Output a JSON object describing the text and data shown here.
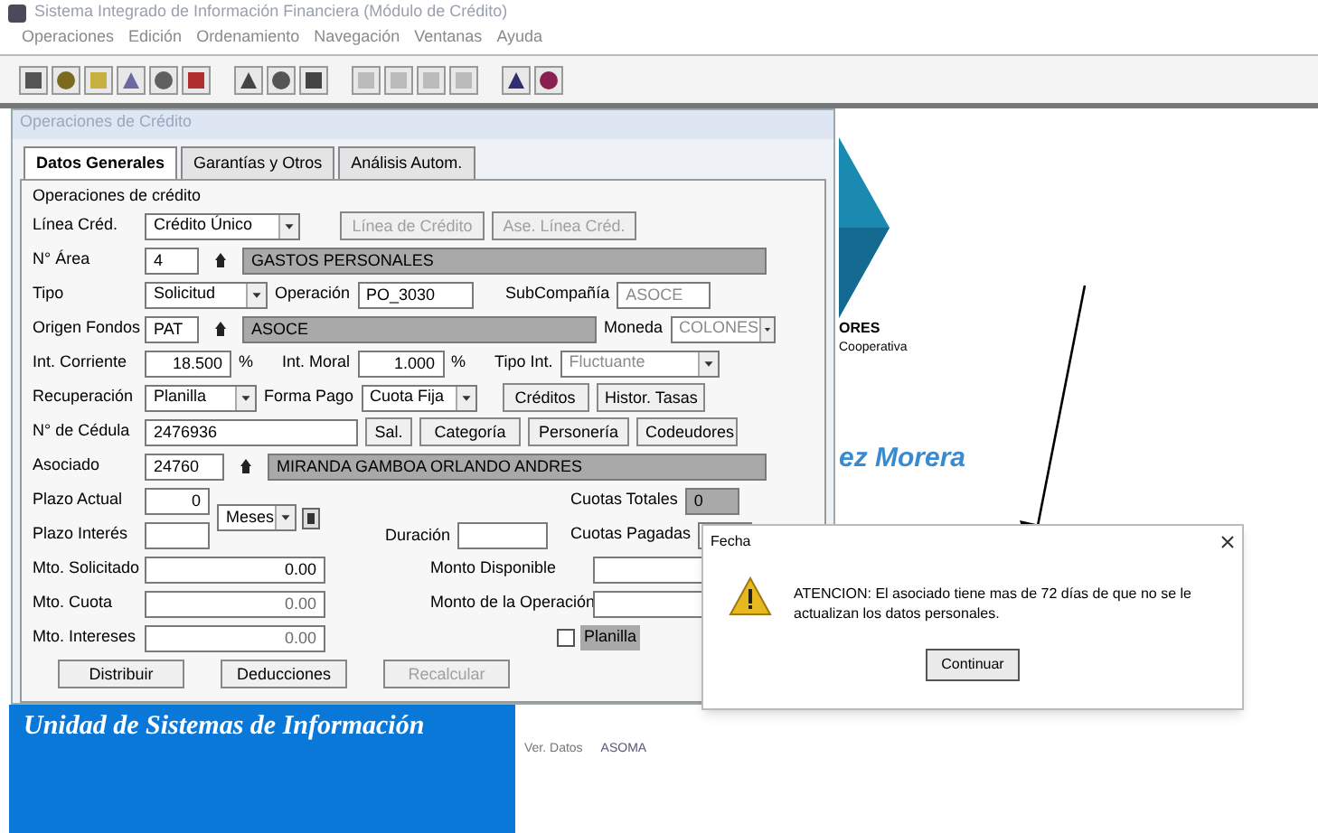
{
  "window": {
    "title": "Sistema Integrado de Información Financiera (Módulo de Crédito)"
  },
  "menu": [
    "Operaciones",
    "Edición",
    "Ordenamiento",
    "Navegación",
    "Ventanas",
    "Ayuda"
  ],
  "form_window": {
    "title": "Operaciones de Crédito",
    "tabs": [
      {
        "label": "Datos Generales",
        "selected": true
      },
      {
        "label": "Garantías y Otros",
        "selected": false
      },
      {
        "label": "Análisis Autom.",
        "selected": false
      }
    ],
    "group_label": "Operaciones de crédito",
    "linea": {
      "label": "Línea Créd.",
      "value": "Crédito Único",
      "buttons": [
        {
          "label": "Línea de Crédito",
          "disabled": true
        },
        {
          "label": "Ase. Línea Créd.",
          "disabled": true
        }
      ]
    },
    "area": {
      "label": "N° Área",
      "code": "4",
      "name": "GASTOS PERSONALES"
    },
    "tipo": {
      "label": "Tipo",
      "value": "Solicitud",
      "operacion_label": "Operación",
      "operacion": "PO_3030",
      "subcompania_label": "SubCompañía",
      "subcompania": "ASOCE"
    },
    "origen": {
      "label": "Origen Fondos",
      "code": "PAT",
      "name": "ASOCE",
      "moneda_label": "Moneda",
      "moneda": "COLONES"
    },
    "interes": {
      "label": "Int. Corriente",
      "value": "18.500",
      "unit": "%",
      "moral_label": "Int. Moral",
      "moral": "1.000",
      "moral_unit": "%",
      "tipo_label": "Tipo Int.",
      "tipo": "Fluctuante"
    },
    "recuperacion": {
      "label": "Recuperación",
      "value": "Planilla",
      "forma_label": "Forma Pago",
      "forma": "Cuota Fija",
      "buttons": [
        {
          "label": "Créditos",
          "disabled": false
        },
        {
          "label": "Histor. Tasas",
          "disabled": false
        }
      ]
    },
    "cedula": {
      "label": "N° de Cédula",
      "value": "2476936",
      "buttons": [
        {
          "label": "Sal.",
          "disabled": false
        },
        {
          "label": "Categoría",
          "disabled": false
        },
        {
          "label": "Personería",
          "disabled": false
        },
        {
          "label": "Codeudores",
          "disabled": false
        }
      ]
    },
    "asociado": {
      "label": "Asociado",
      "code": "24760",
      "name": "MIRANDA GAMBOA ORLANDO ANDRES"
    },
    "plazo": {
      "label": "Plazo Actual",
      "value": "0",
      "interes_label": "Plazo Interés",
      "unit": "Meses",
      "duracion_label": "Duración",
      "cuotas_totales_label": "Cuotas Totales",
      "cuotas_totales": "0",
      "cuotas_pagadas_label": "Cuotas Pagadas"
    },
    "montos": [
      {
        "label": "Mto. Solicitado",
        "value": "0.00",
        "disabled": false,
        "right_label": "Monto Disponible"
      },
      {
        "label": "Mto. Cuota",
        "value": "0.00",
        "disabled": true,
        "right_label": "Monto de la Operación"
      },
      {
        "label": "Mto. Intereses",
        "value": "0.00",
        "disabled": true
      }
    ],
    "planilla_check": {
      "label": "Planilla",
      "checked": false
    },
    "bottom_buttons": [
      {
        "label": "Distribuir",
        "disabled": false
      },
      {
        "label": "Deducciones",
        "disabled": false
      },
      {
        "label": "Recalcular",
        "disabled": true
      }
    ]
  },
  "background": {
    "banner": "Unidad de Sistemas de Información",
    "logo_text": "ORES",
    "logo_subtext": "Cooperativa",
    "name_fragment": "ez Morera",
    "db_label": "Ver. Datos",
    "db_value": "ASOMA"
  },
  "dialog": {
    "title": "Fecha",
    "message": "ATENCION: El asociado tiene mas de 72 días de que no se le actualizan los datos personales.",
    "button": "Continuar"
  }
}
